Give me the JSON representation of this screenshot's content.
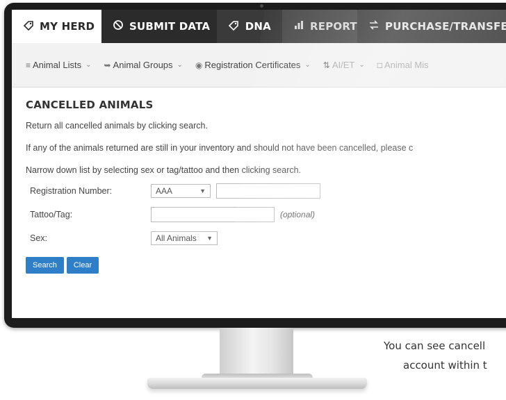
{
  "nav": {
    "tabs": [
      {
        "label": "MY HERD",
        "icon": "tag-icon"
      },
      {
        "label": "SUBMIT DATA",
        "icon": "no-entry-icon"
      },
      {
        "label": "DNA",
        "icon": "tag-icon"
      },
      {
        "label": "REPORTS",
        "icon": "bar-chart-icon"
      },
      {
        "label": "PURCHASE/TRANSFER",
        "icon": "transfer-icon"
      }
    ]
  },
  "subnav": {
    "items": [
      {
        "label": "Animal Lists",
        "icon": "list-icon"
      },
      {
        "label": "Animal Groups",
        "icon": "groups-icon"
      },
      {
        "label": "Registration Certificates",
        "icon": "certificate-icon"
      },
      {
        "label": "AI/ET",
        "icon": "ai-et-icon"
      },
      {
        "label": "Animal Mis",
        "icon": "folder-icon"
      }
    ]
  },
  "page": {
    "title": "CANCELLED ANIMALS",
    "line1": "Return all cancelled animals by clicking search.",
    "line2": "If any of the animals returned are still in your inventory and should not have been cancelled, please c",
    "line3": "Narrow down list by selecting sex or tag/tattoo and then clicking search."
  },
  "form": {
    "registration_label": "Registration Number:",
    "registration_prefix": "AAA",
    "registration_value": "",
    "tattoo_label": "Tattoo/Tag:",
    "tattoo_value": "",
    "optional_text": "(optional)",
    "sex_label": "Sex:",
    "sex_value": "All Animals"
  },
  "buttons": {
    "search": "Search",
    "clear": "Clear"
  },
  "caption": {
    "line1": "You can see cancell",
    "line2": "account within t"
  }
}
